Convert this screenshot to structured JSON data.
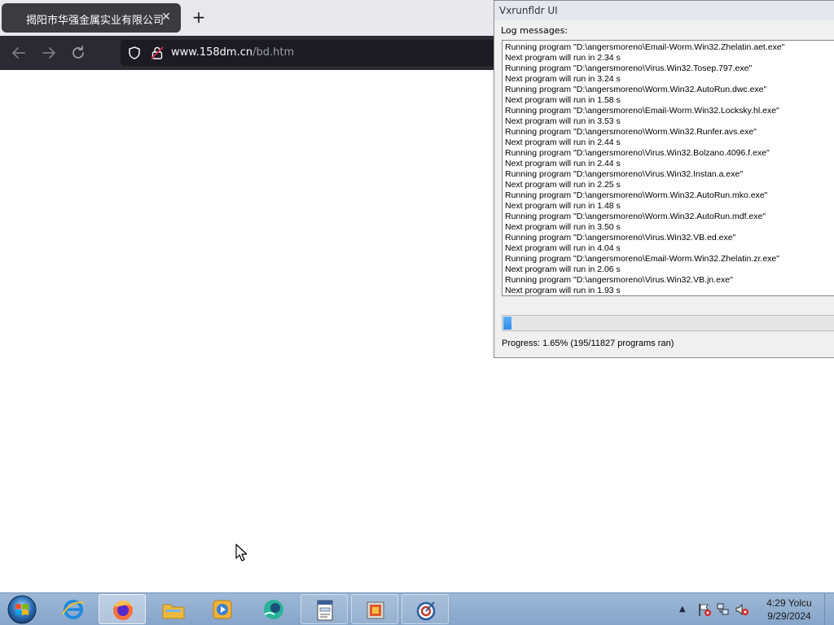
{
  "browser": {
    "tab_title": "揭阳市华强金属实业有限公司",
    "url_host": "www.158dm.cn",
    "url_path": "/bd.htm"
  },
  "dialog": {
    "title": "Vxrunfldr UI",
    "log_label": "Log messages:",
    "log_lines": [
      "Running program \"D:\\angersmoreno\\Email-Worm.Win32.Zhelatin.aet.exe\"",
      "Next program will run in 2.34 s",
      "Running program \"D:\\angersmoreno\\Virus.Win32.Tosep.797.exe\"",
      "Next program will run in 3.24 s",
      "Running program \"D:\\angersmoreno\\Worm.Win32.AutoRun.dwc.exe\"",
      "Next program will run in 1.58 s",
      "Running program \"D:\\angersmoreno\\Email-Worm.Win32.Locksky.hl.exe\"",
      "Next program will run in 3.53 s",
      "Running program \"D:\\angersmoreno\\Worm.Win32.Runfer.avs.exe\"",
      "Next program will run in 2.44 s",
      "Running program \"D:\\angersmoreno\\Virus.Win32.Bolzano.4096.f.exe\"",
      "Next program will run in 2.44 s",
      "Running program \"D:\\angersmoreno\\Virus.Win32.Instan.a.exe\"",
      "Next program will run in 2.25 s",
      "Running program \"D:\\angersmoreno\\Worm.Win32.AutoRun.mko.exe\"",
      "Next program will run in 1.48 s",
      "Running program \"D:\\angersmoreno\\Worm.Win32.AutoRun.mdf.exe\"",
      "Next program will run in 3.50 s",
      "Running program \"D:\\angersmoreno\\Virus.Win32.VB.ed.exe\"",
      "Next program will run in 4.04 s",
      "Running program \"D:\\angersmoreno\\Email-Worm.Win32.Zhelatin.zr.exe\"",
      "Next program will run in 2.06 s",
      "Running program \"D:\\angersmoreno\\Virus.Win32.VB.jn.exe\"",
      "Next program will run in 1.93 s"
    ],
    "progress_fraction": 0.0165,
    "progress_text": "Progress: 1.65% (195/11827 programs ran)"
  },
  "taskbar": {
    "items": [
      "start-orb-icon",
      "internet-explorer-icon",
      "firefox-icon",
      "file-explorer-icon",
      "media-player-icon",
      "app-icon",
      "document-icon",
      "archive-icon",
      "tool-icon"
    ],
    "clock_time": "4:29 Yolcu",
    "clock_date": "9/29/2024"
  },
  "colors": {
    "browser_nav": "#2b2a33",
    "browser_tab": "#3b3b40",
    "taskbar": "#9eb8d6",
    "progress": "#2d8de6"
  }
}
